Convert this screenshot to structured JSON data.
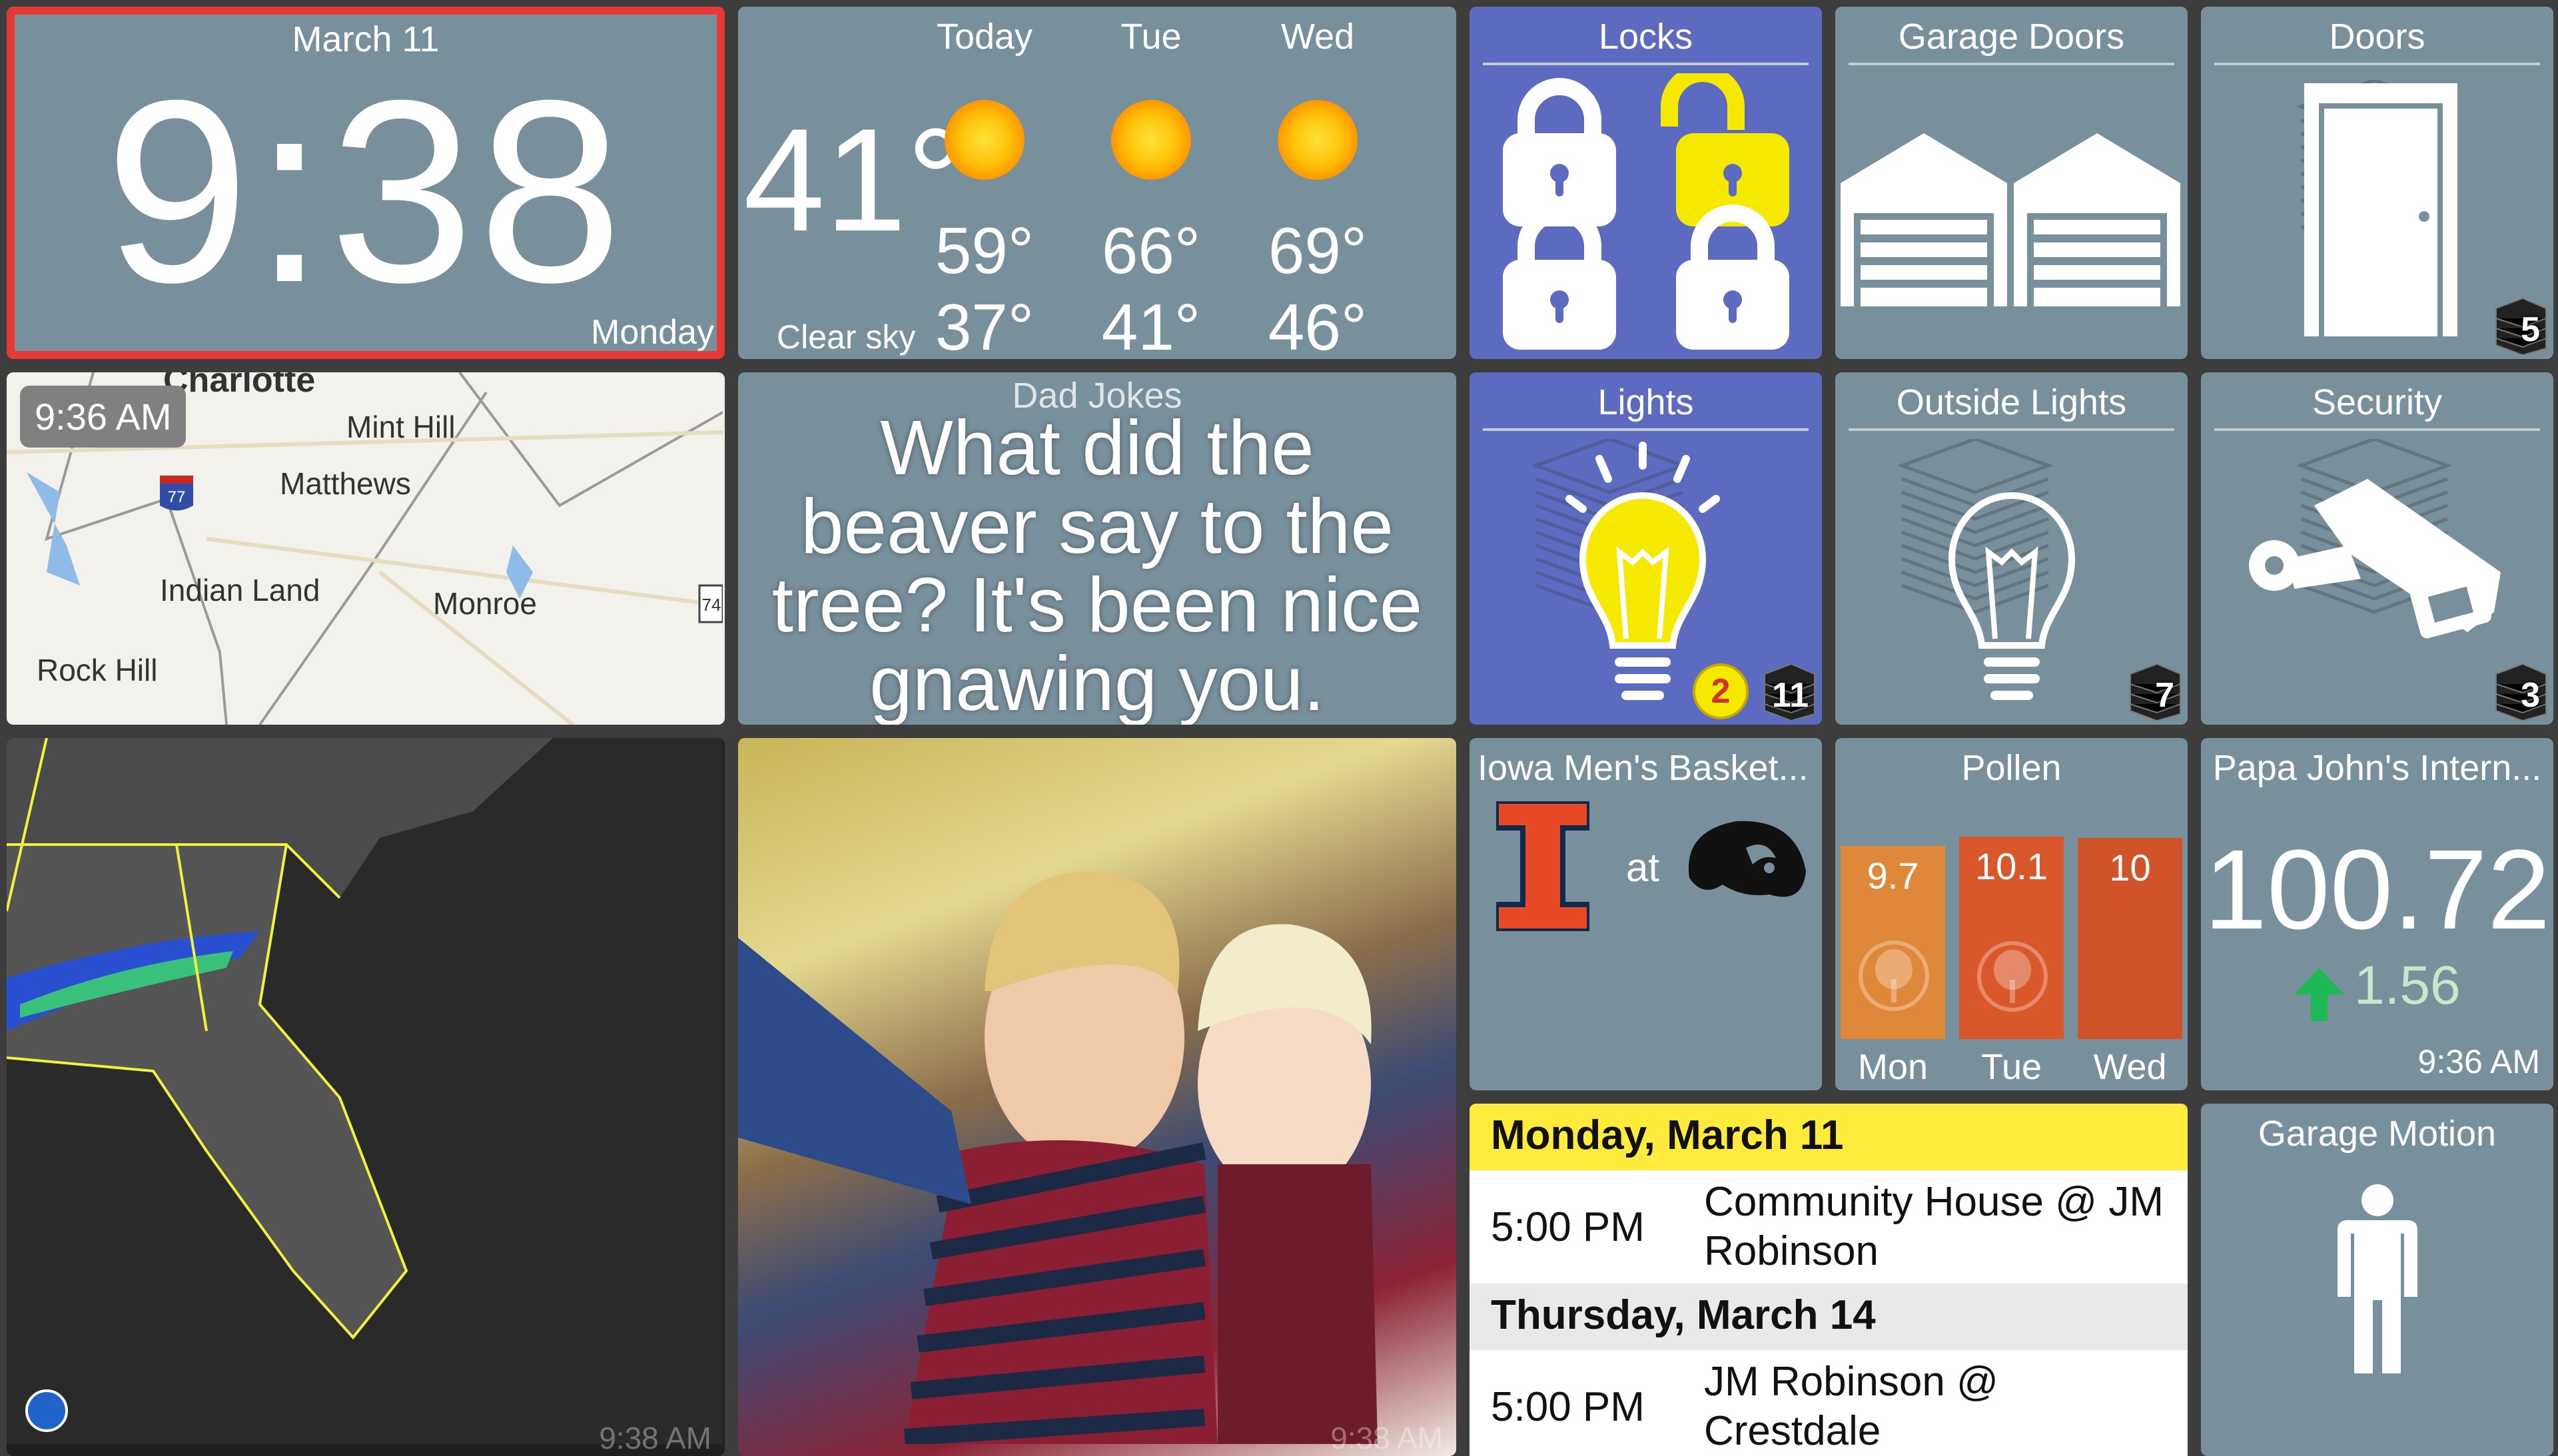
{
  "clock": {
    "date": "March 11",
    "time": "9:38",
    "weekday": "Monday"
  },
  "weather": {
    "current_temp": "41°",
    "condition": "Clear sky",
    "forecast": [
      {
        "day": "Today",
        "high": "59°",
        "low": "37°",
        "icon": "sun-icon"
      },
      {
        "day": "Tue",
        "high": "66°",
        "low": "41°",
        "icon": "sun-icon"
      },
      {
        "day": "Wed",
        "high": "69°",
        "low": "46°",
        "icon": "sun-icon"
      }
    ]
  },
  "locks": {
    "title": "Locks",
    "states": [
      "locked",
      "unlocked",
      "locked",
      "locked"
    ]
  },
  "garage_doors": {
    "title": "Garage Doors"
  },
  "doors": {
    "title": "Doors",
    "count": "5"
  },
  "map": {
    "time": "9:36 AM",
    "places": [
      "Charlotte",
      "Mint Hill",
      "Matthews",
      "Indian Land",
      "Monroe",
      "Rock Hill"
    ],
    "shields": [
      "77",
      "74"
    ]
  },
  "dad_jokes": {
    "title": "Dad Jokes",
    "text": "What did the beaver say to the tree? It's been nice gnawing you."
  },
  "lights": {
    "title": "Lights",
    "on_count": "2",
    "count": "11"
  },
  "outside_lights": {
    "title": "Outside Lights",
    "count": "7"
  },
  "security": {
    "title": "Security",
    "count": "3"
  },
  "radar": {
    "timestamp": "9:38 AM"
  },
  "photo": {
    "timestamp": "9:38 AM"
  },
  "sports": {
    "title": "Iowa Men's Basket...",
    "separator": "at"
  },
  "pollen": {
    "title": "Pollen",
    "days": [
      {
        "day": "Mon",
        "value": "9.7",
        "color": "#e0883a"
      },
      {
        "day": "Tue",
        "value": "10.1",
        "color": "#d9582b"
      },
      {
        "day": "Wed",
        "value": "10",
        "color": "#d0532a"
      }
    ]
  },
  "stock": {
    "title": "Papa John's Intern...",
    "price": "100.72",
    "change": "1.56",
    "direction": "up",
    "time": "9:36 AM"
  },
  "calendar": {
    "groups": [
      {
        "date": "Monday, March 11",
        "events": [
          {
            "time": "5:00 PM",
            "title": "Community House @ JM Robinson"
          }
        ]
      },
      {
        "date": "Thursday, March 14",
        "events": [
          {
            "time": "5:00 PM",
            "title": "JM Robinson @ Crestdale"
          }
        ]
      }
    ]
  },
  "garage_motion": {
    "title": "Garage Motion"
  },
  "colors": {
    "tile": "#78909c",
    "active_tile": "#5c6bc0",
    "background": "#3d3d3d",
    "clock_border": "#e53935",
    "calendar_header": "#ffeb3b",
    "unlocked": "#f5e900",
    "stock_up": "#1db954"
  }
}
